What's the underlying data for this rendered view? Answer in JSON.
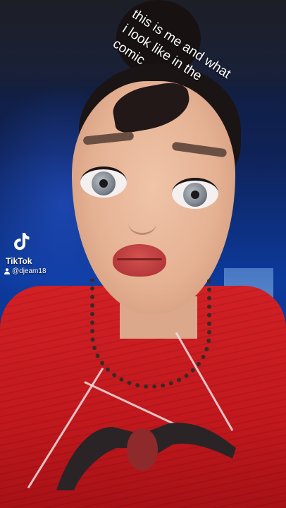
{
  "caption": {
    "line1": "this is me and what",
    "line2": "i look like in the",
    "line3": "comic"
  },
  "watermark": {
    "brand": "TikTok",
    "username": "@djeam18",
    "logo_icon": "tiktok-logo-icon",
    "user_icon": "person-icon"
  },
  "colors": {
    "sweater": "#c2181d",
    "background": "#0c3a9c",
    "lips": "#b6383a"
  }
}
